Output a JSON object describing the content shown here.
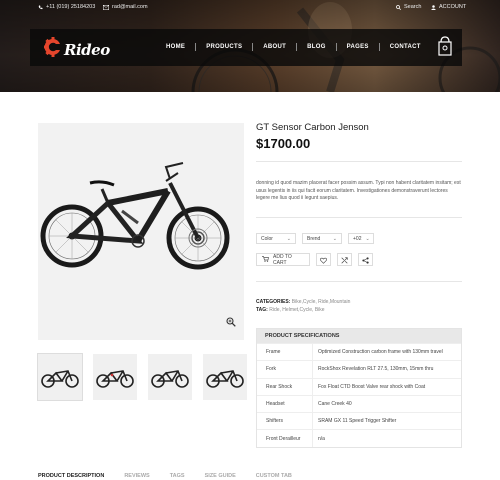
{
  "topbar": {
    "phone": "+11 (019) 25184203",
    "email": "rad@mail.com",
    "search": "Search",
    "account": "ACCOUNT"
  },
  "brand": {
    "name": "Rideo",
    "accent": "#e5452c"
  },
  "nav": {
    "items": [
      "HOME",
      "PRODUCTS",
      "ABOUT",
      "BLOG",
      "PAGES",
      "CONTACT"
    ]
  },
  "product": {
    "title": "GT Sensor Carbon Jenson",
    "price": "$1700.00",
    "description": "donning id quod mazim placerat facer possim assum. Typi non habent claritatem insitam; est usus legentis in iis qui facit eorum claritatem. Investigationes demonstraverunt lectores legere me lius quod ii legunt saepius.",
    "selects": [
      {
        "label": "Color"
      },
      {
        "label": "Brend"
      },
      {
        "label": "+02"
      }
    ],
    "add_to_cart": "ADD TO CART",
    "categories_label": "CATEGORIES:",
    "categories_value": "Bike,Cycle, Ride,Mountain",
    "tag_label": "TAG:",
    "tag_value": "Ride, Helmet,Cycle, Bike"
  },
  "specs": {
    "heading": "PRODUCT SPECIFICATIONS",
    "rows": [
      {
        "key": "Frame",
        "value": "Optimized Construction carbon frame with 130mm travel"
      },
      {
        "key": "Fork",
        "value": "RockShox Revelation RLT 27.5, 130mm, 15mm thru"
      },
      {
        "key": "Rear Shock",
        "value": "Fox Float CTD Boost Valve rear shock with Coat"
      },
      {
        "key": "Headset",
        "value": "Cane Creek 40"
      },
      {
        "key": "Shifters",
        "value": "SRAM GX 11 Speed Trigger Shifter"
      },
      {
        "key": "Front Derailleur",
        "value": "n/a"
      }
    ]
  },
  "tabs": [
    "PRODUCT DESCRIPTION",
    "REVIEWS",
    "TAGS",
    "SIZE GUIDE",
    "CUSTOM TAB"
  ],
  "icons": {
    "phone": "phone-icon",
    "mail": "mail-icon",
    "search": "search-icon",
    "account": "user-icon",
    "cart": "shopping-bag-icon",
    "zoom": "zoom-icon",
    "heart": "heart-icon",
    "compare": "compare-icon",
    "share": "share-icon"
  }
}
